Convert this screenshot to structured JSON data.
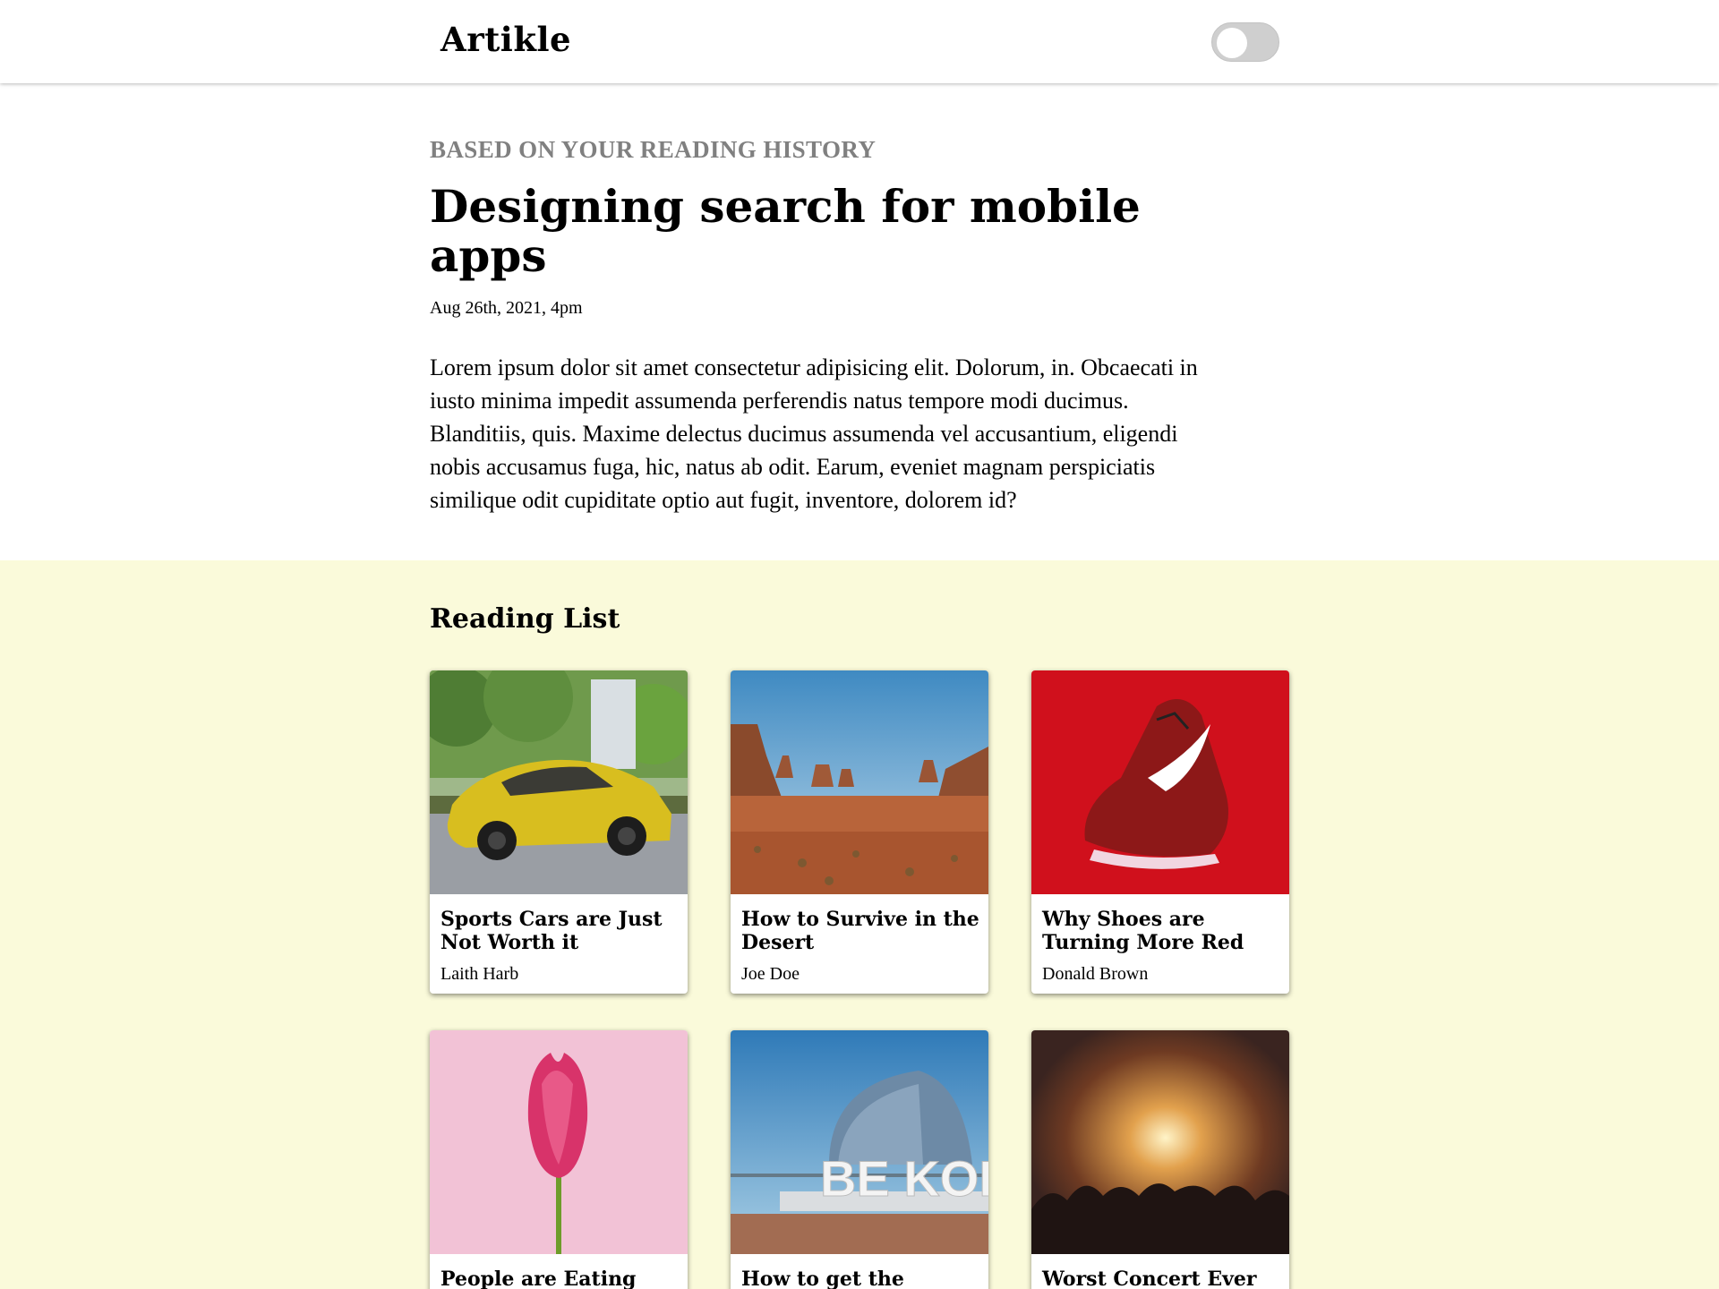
{
  "nav": {
    "brand": "Artikle",
    "toggle_icon": "theme-toggle"
  },
  "hero": {
    "eyebrow": "BASED ON YOUR READING HISTORY",
    "title": "Designing search for mobile apps",
    "date": "Aug 26th, 2021, 4pm",
    "body": "Lorem ipsum dolor sit amet consectetur adipisicing elit. Dolorum, in. Obcaecati in iusto minima impedit assumenda perferendis natus tempore modi ducimus. Blanditiis, quis. Maxime delectus ducimus assumenda vel accusantium, eligendi nobis accusamus fuga, hic, natus ab odit. Earum, eveniet magnam perspiciatis similique odit cupiditate optio aut fugit, inventore, dolorem id?"
  },
  "reading_list": {
    "title": "Reading List",
    "cards": [
      {
        "title": "Sports Cars are Just Not Worth it",
        "author": "Laith Harb",
        "image": "yellow-sports-car-photo"
      },
      {
        "title": "How to Survive in the Desert",
        "author": "Joe Doe",
        "image": "desert-landscape-photo"
      },
      {
        "title": "Why Shoes are Turning More Red",
        "author": "Donald Brown",
        "image": "red-sneaker-photo"
      },
      {
        "title": "People are Eating this",
        "author": "",
        "image": "pink-tulip-photo"
      },
      {
        "title": "How to get the",
        "author": "",
        "image": "be-kobe-sign-photo",
        "image_text": "BE KOBE"
      },
      {
        "title": "Worst Concert Ever",
        "author": "",
        "image": "concert-crowd-photo"
      }
    ]
  }
}
